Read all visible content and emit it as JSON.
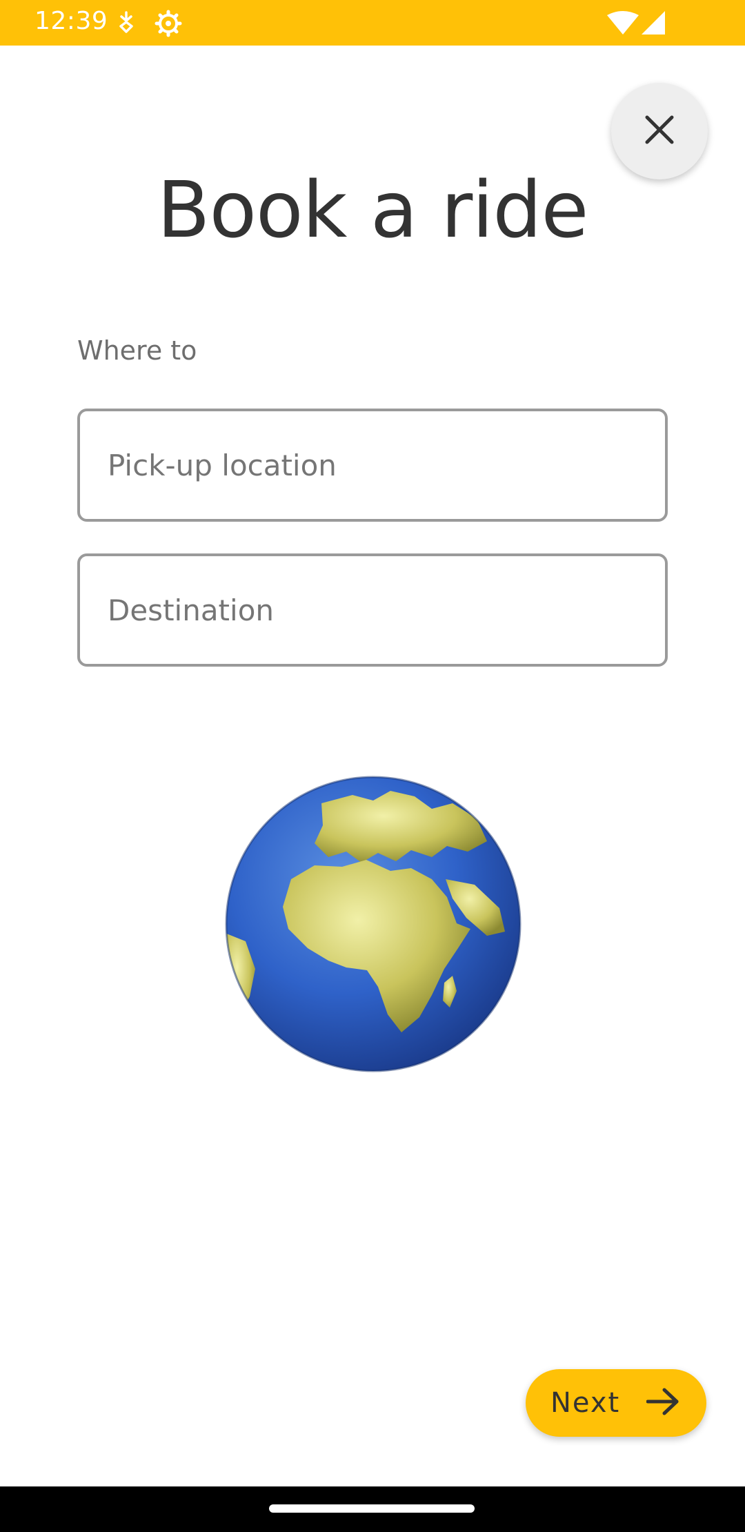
{
  "status_bar": {
    "time": "12:39",
    "background_color": "#FFC107",
    "icons": [
      "sync-icon",
      "settings-icon",
      "wifi-icon",
      "signal-icon"
    ]
  },
  "header": {
    "close_icon": "close-icon",
    "title": "Book a ride"
  },
  "form": {
    "section_label": "Where to",
    "pickup": {
      "placeholder": "Pick-up location",
      "value": ""
    },
    "destination": {
      "placeholder": "Destination",
      "value": ""
    }
  },
  "illustration": {
    "icon": "globe-europe-africa-icon"
  },
  "footer": {
    "next_label": "Next",
    "next_icon": "arrow-right-icon",
    "accent_color": "#FFC107"
  }
}
